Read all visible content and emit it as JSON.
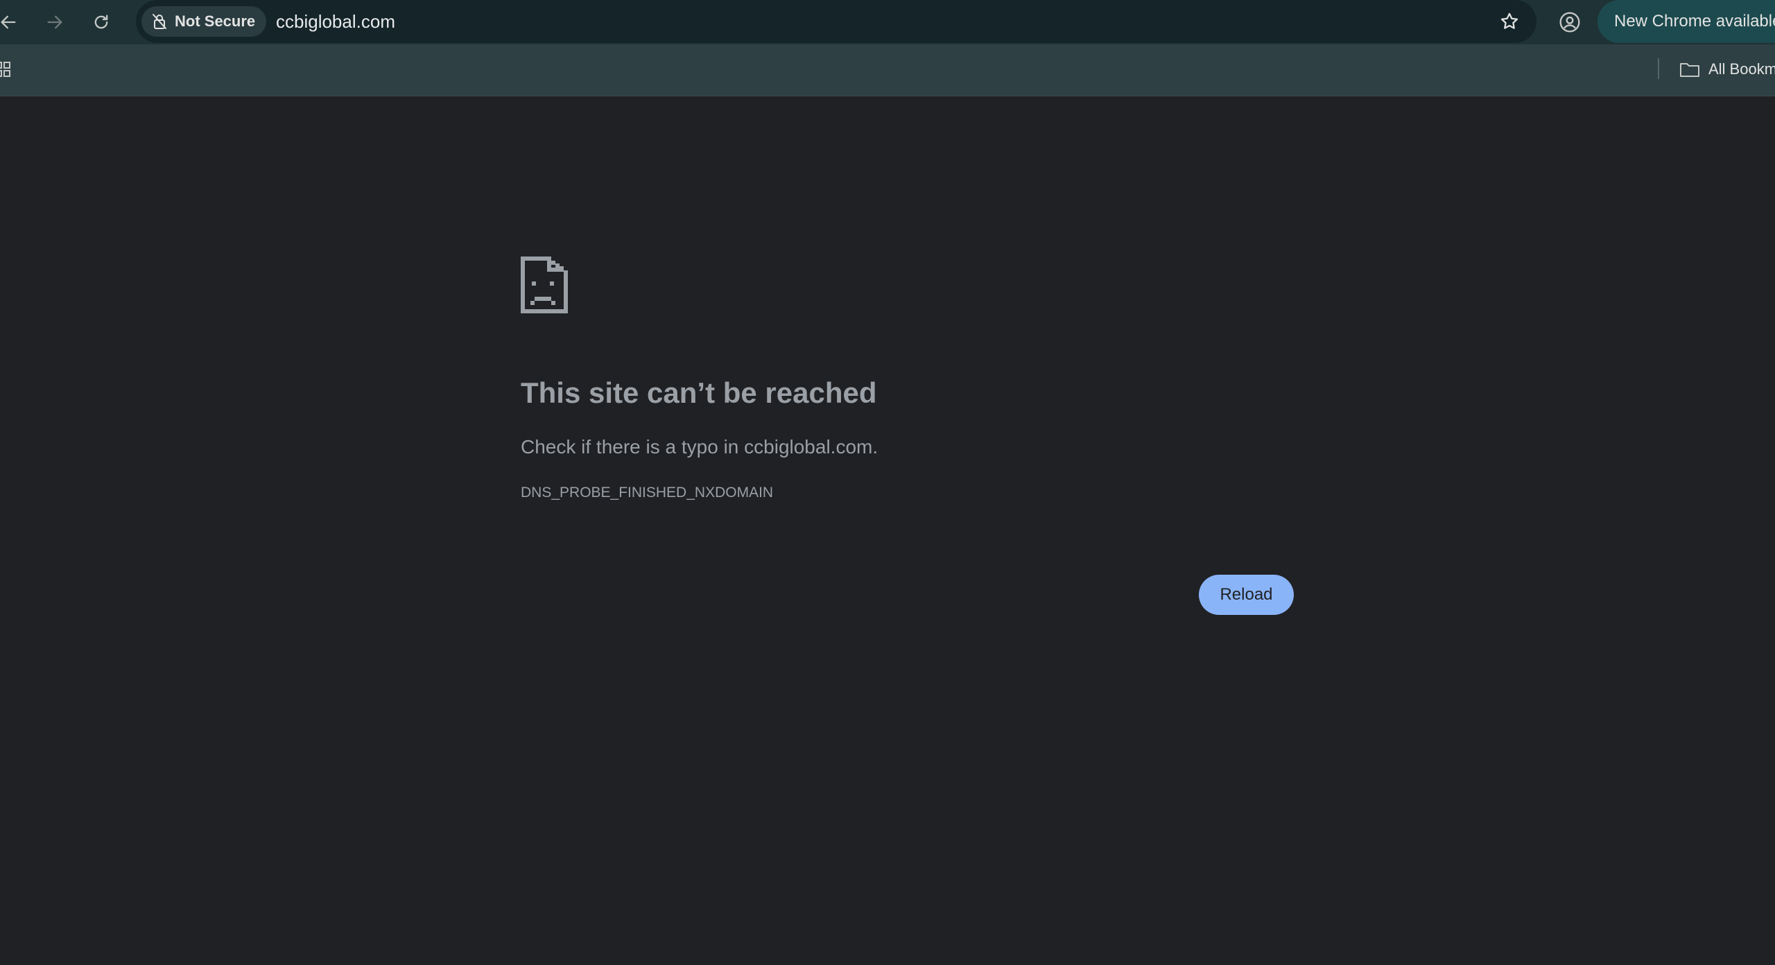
{
  "toolbar": {
    "security_label": "Not Secure",
    "url": "ccbiglobal.com",
    "update_label": "New Chrome available",
    "icons": [
      "back-icon",
      "forward-icon",
      "reload-icon",
      "not-secure-icon",
      "star-icon",
      "profile-icon"
    ]
  },
  "bookmarks": {
    "all_bookmarks_label": "All Bookmarks",
    "icons": [
      "apps-grid-icon",
      "folder-icon"
    ]
  },
  "error_page": {
    "title": "This site can’t be reached",
    "description": "Check if there is a typo in ccbiglobal.com.",
    "error_code": "DNS_PROBE_FINISHED_NXDOMAIN",
    "reload_label": "Reload",
    "icon": "sad-document-icon"
  },
  "colors": {
    "toolbar_bg": "#1f3236",
    "bookmarks_bg": "#2e4044",
    "page_bg": "#202124",
    "text_muted": "#9aa0a6",
    "button_accent": "#8ab4f8"
  }
}
